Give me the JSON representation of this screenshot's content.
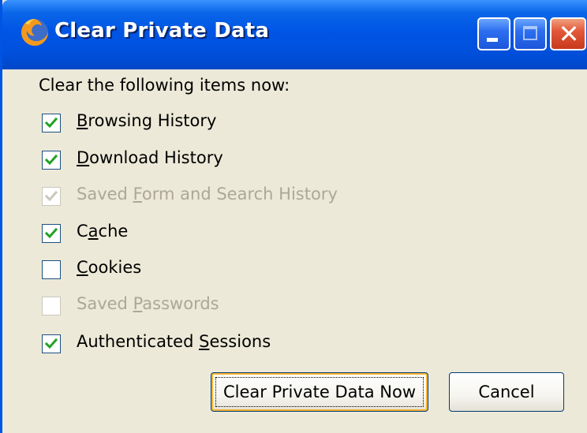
{
  "window": {
    "title": "Clear Private Data",
    "app_icon": "firefox-icon",
    "titlebar_buttons": [
      "minimize-icon",
      "maximize-icon",
      "close-icon"
    ],
    "close_glyph": "✕"
  },
  "dialog": {
    "heading": "Clear the following items now:",
    "items": [
      {
        "pre": "",
        "mnemonic": "B",
        "post": "rowsing History",
        "checked": true,
        "enabled": true
      },
      {
        "pre": "",
        "mnemonic": "D",
        "post": "ownload History",
        "checked": true,
        "enabled": true
      },
      {
        "pre": "Saved ",
        "mnemonic": "F",
        "post": "orm and Search History",
        "checked": true,
        "enabled": false
      },
      {
        "pre": "C",
        "mnemonic": "a",
        "post": "che",
        "checked": true,
        "enabled": true
      },
      {
        "pre": "",
        "mnemonic": "C",
        "post": "ookies",
        "checked": false,
        "enabled": true
      },
      {
        "pre": "Saved ",
        "mnemonic": "P",
        "post": "asswords",
        "checked": false,
        "enabled": false
      },
      {
        "pre": "Authenticated ",
        "mnemonic": "S",
        "post": "essions",
        "checked": true,
        "enabled": true
      }
    ],
    "buttons": {
      "clear_now": "Clear Private Data Now",
      "cancel": "Cancel"
    }
  },
  "colors": {
    "titlebar": "#0055e5",
    "dialog_bg": "#ece9d8",
    "check_enabled": "#21a121",
    "check_disabled": "#cac8bb",
    "label_disabled": "#aca899"
  }
}
